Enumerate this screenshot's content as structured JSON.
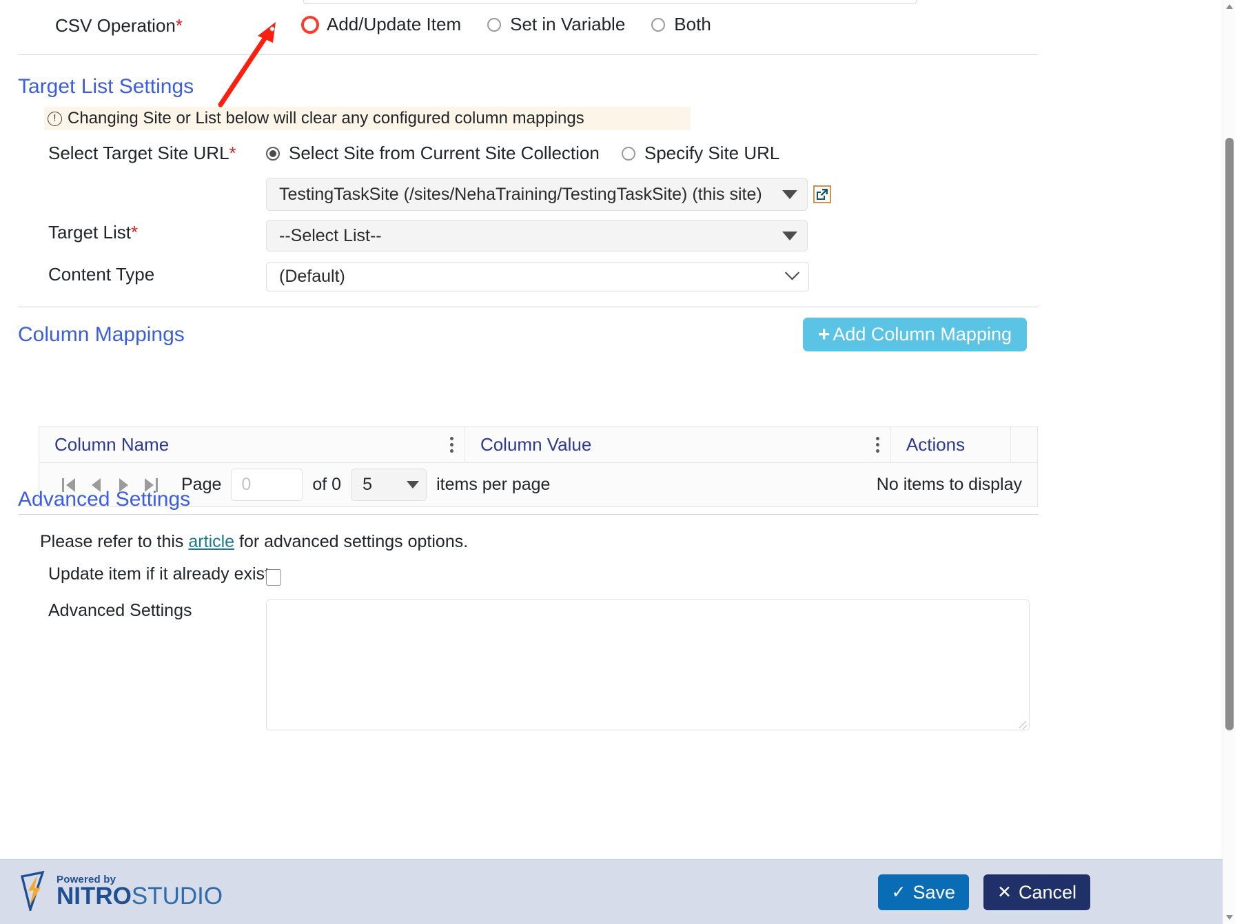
{
  "form": {
    "csv_operation": {
      "label": "CSV Operation",
      "required_mark": "*",
      "options": [
        {
          "label": "Add/Update Item",
          "selected": true
        },
        {
          "label": "Set in Variable",
          "selected": false
        },
        {
          "label": "Both",
          "selected": false
        }
      ]
    },
    "target_list_settings": {
      "title": "Target List Settings",
      "warning": "Changing Site or List below will clear any configured column mappings",
      "select_target_site_url": {
        "label": "Select Target Site URL",
        "required_mark": "*",
        "options": [
          {
            "label": "Select Site from Current Site Collection",
            "selected": true
          },
          {
            "label": "Specify Site URL",
            "selected": false
          }
        ],
        "site_value": "TestingTaskSite (/sites/NehaTraining/TestingTaskSite) (this site)",
        "open_site_icon": "external-link-icon"
      },
      "target_list": {
        "label": "Target List",
        "required_mark": "*",
        "value": "--Select List--"
      },
      "content_type": {
        "label": "Content Type",
        "value": "(Default)"
      }
    },
    "column_mappings": {
      "title": "Column Mappings",
      "add_button": "Add Column Mapping",
      "add_button_icon": "plus-icon",
      "columns": [
        "Column Name",
        "Column Value",
        "Actions"
      ],
      "rows": [],
      "pager": {
        "first_icon": "go-to-first-page-icon",
        "prev_icon": "previous-page-icon",
        "next_icon": "next-page-icon",
        "last_icon": "go-to-last-page-icon",
        "page_label": "Page",
        "page_value": "",
        "page_placeholder": "0",
        "of_label": "of 0",
        "page_size": "5",
        "items_per_page_label": "items per page",
        "empty_text": "No items to display"
      }
    },
    "advanced_settings": {
      "title": "Advanced Settings",
      "note_prefix": "Please refer to this ",
      "note_link": "article",
      "note_suffix": " for advanced settings options.",
      "update_if_exists": {
        "label": "Update item if it already exists",
        "checked": false
      },
      "textarea": {
        "label": "Advanced Settings",
        "value": ""
      }
    }
  },
  "footer": {
    "logo": {
      "powered_by": "Powered by",
      "nitro": "NITRO",
      "studio": "STUDIO"
    },
    "save_label": "Save",
    "save_icon": "check-icon",
    "cancel_label": "Cancel",
    "cancel_icon": "close-icon"
  },
  "colors": {
    "heading_blue": "#3b5ee0",
    "grid_header_blue": "#2b3a8f",
    "add_button": "#5bc3e3",
    "save_button": "#0a6cb5",
    "cancel_button": "#1f3168",
    "warning_bg": "#fdf6e8",
    "link_teal": "#1f7a8c",
    "annotation_red": "#fc3b2d",
    "footer_bg": "#d6dcea"
  }
}
